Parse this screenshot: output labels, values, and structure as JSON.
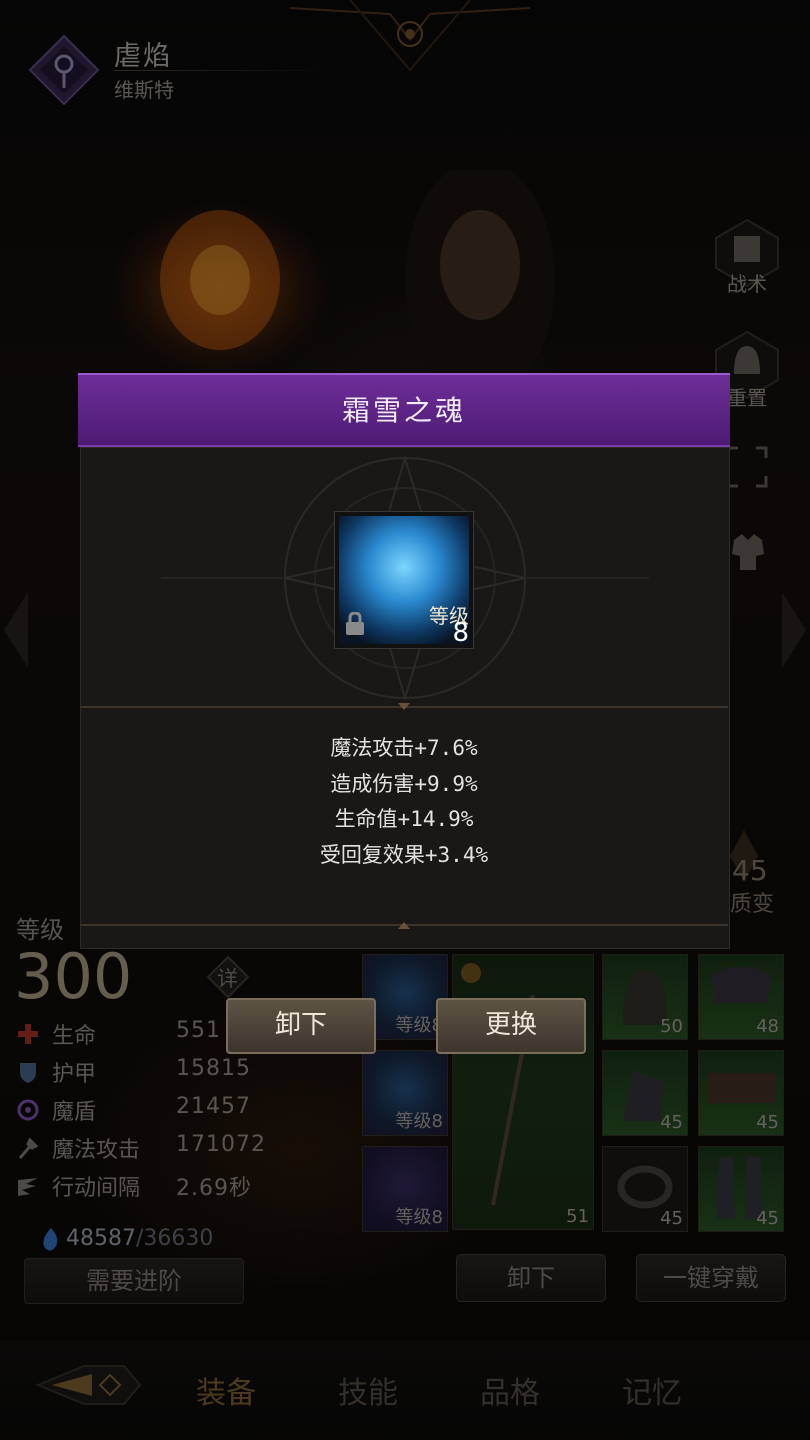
{
  "header": {
    "name": "虐焰",
    "subtitle": "维斯特"
  },
  "side_buttons": [
    {
      "label": "战术",
      "icon": "banner-icon"
    },
    {
      "label": "重置",
      "icon": "helmet-icon"
    },
    {
      "label": "",
      "icon": "expand-icon"
    },
    {
      "label": "",
      "icon": "armor-icon"
    }
  ],
  "transform": {
    "value": "45",
    "label": "质变"
  },
  "stats": {
    "level_label": "等级",
    "level": "300",
    "detail_label": "详",
    "rows": [
      {
        "name": "生命",
        "value": "551",
        "icon": "heart-cross-icon",
        "color": "#c0392b"
      },
      {
        "name": "护甲",
        "value": "15815",
        "icon": "shield-icon",
        "color": "#5d7fa8"
      },
      {
        "name": "魔盾",
        "value": "21457",
        "icon": "magic-swirl-icon",
        "color": "#8a5cc4"
      },
      {
        "name": "魔法攻击",
        "value": "171072",
        "icon": "staff-icon",
        "color": "#9a9388"
      },
      {
        "name": "行动间隔",
        "value": "2.69秒",
        "icon": "wing-icon",
        "color": "#9a9388"
      }
    ],
    "power_current": "48587",
    "power_max": "/36630",
    "advance_label": "需要进阶"
  },
  "equipment": {
    "jewel_slots": [
      {
        "tag": "等级8",
        "quality": "blue"
      },
      {
        "tag": "等级8",
        "quality": "blue"
      },
      {
        "tag": "等级8",
        "quality": "purple"
      }
    ],
    "weapon_level": "51",
    "gear": [
      {
        "level": "50",
        "icon": "helmet-icon"
      },
      {
        "level": "48",
        "icon": "chest-armor-icon"
      },
      {
        "level": "45",
        "icon": "gauntlet-icon"
      },
      {
        "level": "45",
        "icon": "belt-icon"
      },
      {
        "level": "45",
        "icon": "ring-icon"
      },
      {
        "level": "45",
        "icon": "greaves-icon"
      }
    ],
    "unequip_label": "卸下",
    "equip_all_label": "一键穿戴"
  },
  "tabs": [
    {
      "label": "装备",
      "active": true
    },
    {
      "label": "技能",
      "active": false
    },
    {
      "label": "品格",
      "active": false
    },
    {
      "label": "记忆",
      "active": false
    }
  ],
  "modal": {
    "title": "霜雪之魂",
    "item": {
      "level_label": "等级",
      "level": "8",
      "locked": true
    },
    "effects": [
      "魔法攻击+7.6%",
      "造成伤害+9.9%",
      "生命值+14.9%",
      "受回复效果+3.4%"
    ],
    "unequip_button": "卸下",
    "replace_button": "更换"
  }
}
